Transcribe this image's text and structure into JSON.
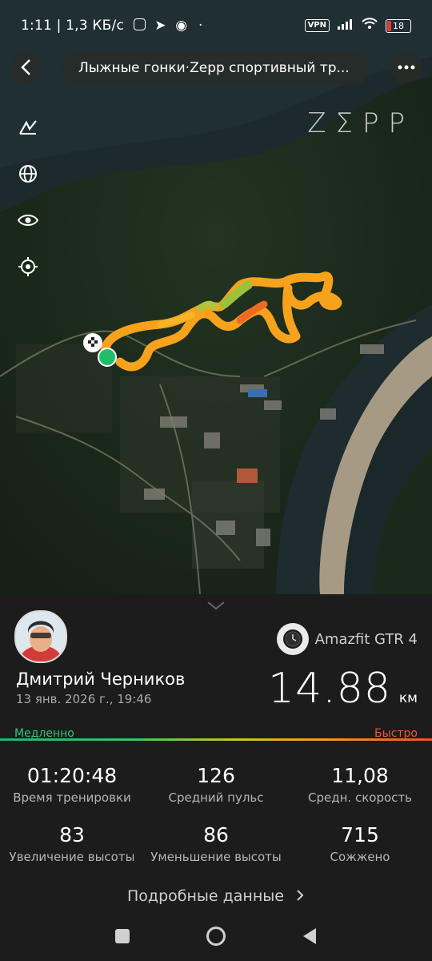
{
  "status_bar": {
    "time": "1:11",
    "network_speed": "1,3 КБ/с",
    "vpn_label": "VPN",
    "battery": "18"
  },
  "header": {
    "title": "Лыжные гонки·Zepp спортивный тр..."
  },
  "map": {
    "watermark": "ZΣPP",
    "tools": [
      "measure-icon",
      "globe-icon",
      "eye-icon",
      "locate-icon"
    ]
  },
  "profile": {
    "name": "Дмитрий Черников",
    "date": "13 янв. 2026 г., 19:46"
  },
  "device": {
    "name": "Amazfit GTR 4"
  },
  "distance": {
    "value": "14.88",
    "unit": "км"
  },
  "pace_scale": {
    "slow_label": "Медленно",
    "fast_label": "Быстро",
    "colors": [
      "#1fb36a",
      "#c8c820",
      "#f39a1e",
      "#f04e30"
    ]
  },
  "stats": [
    {
      "value": "01:20:48",
      "label": "Время тренировки"
    },
    {
      "value": "126",
      "label": "Средний пульс"
    },
    {
      "value": "11,08",
      "label": "Средн. скорость"
    },
    {
      "value": "83",
      "label": "Увеличение высоты"
    },
    {
      "value": "86",
      "label": "Уменьшение высоты"
    },
    {
      "value": "715",
      "label": "Сожжено"
    }
  ],
  "details_link": "Подробные данные"
}
